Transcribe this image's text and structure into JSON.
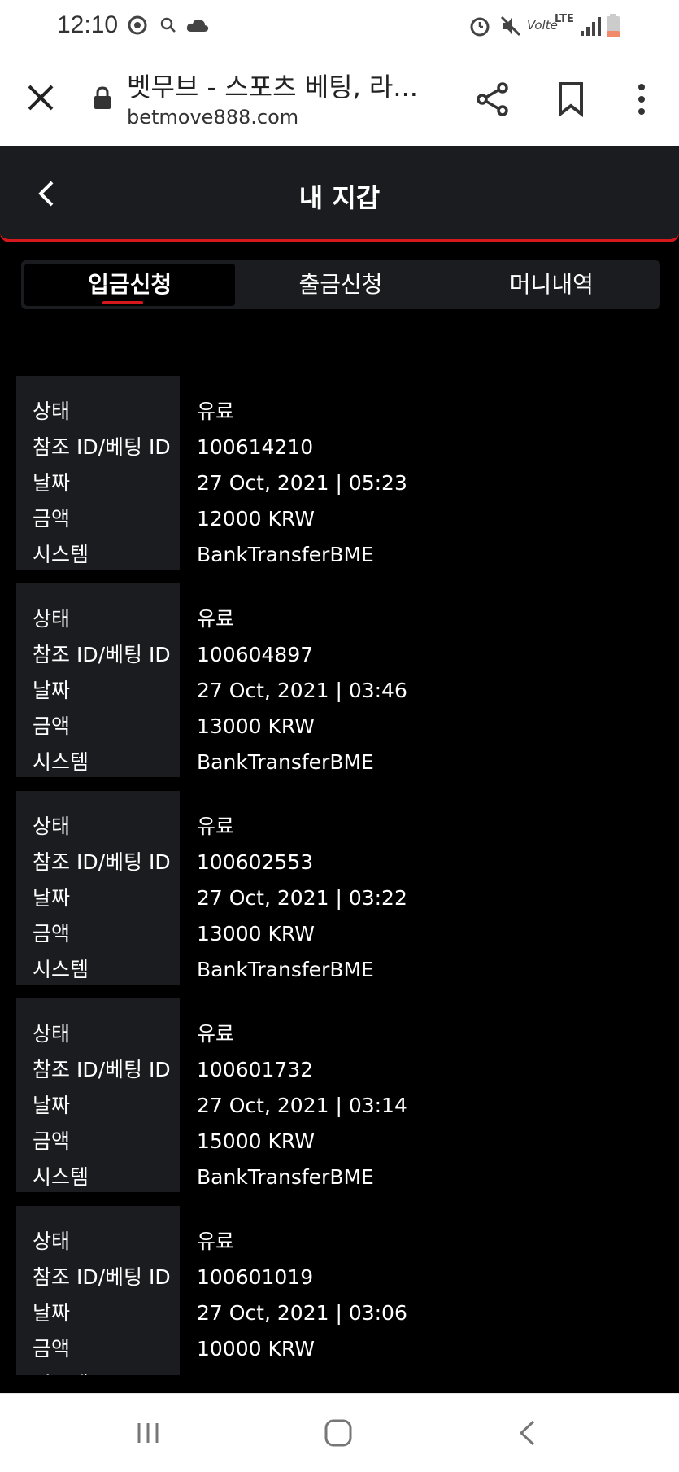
{
  "status_bar": {
    "time": "12:10",
    "network": "LTE",
    "volte": "Volte"
  },
  "browser": {
    "title": "벳무브 - 스포츠 베팅, 라...",
    "url": "betmove888.com"
  },
  "header": {
    "title": "내 지갑"
  },
  "tabs": [
    {
      "label": "입금신청",
      "active": true
    },
    {
      "label": "출금신청",
      "active": false
    },
    {
      "label": "머니내역",
      "active": false
    }
  ],
  "labels": {
    "status": "상태",
    "ref_id": "참조 ID/베팅 ID",
    "date": "날짜",
    "amount": "금액",
    "system": "시스템"
  },
  "records": [
    {
      "status": "유료",
      "ref_id": "100614210",
      "date": "27 Oct, 2021 | 05:23",
      "amount": "12000 KRW",
      "system": "BankTransferBME"
    },
    {
      "status": "유료",
      "ref_id": "100604897",
      "date": "27 Oct, 2021 | 03:46",
      "amount": "13000 KRW",
      "system": "BankTransferBME"
    },
    {
      "status": "유료",
      "ref_id": "100602553",
      "date": "27 Oct, 2021 | 03:22",
      "amount": "13000 KRW",
      "system": "BankTransferBME"
    },
    {
      "status": "유료",
      "ref_id": "100601732",
      "date": "27 Oct, 2021 | 03:14",
      "amount": "15000 KRW",
      "system": "BankTransferBME"
    },
    {
      "status": "유료",
      "ref_id": "100601019",
      "date": "27 Oct, 2021 | 03:06",
      "amount": "10000 KRW",
      "system": "BankTransferBME"
    }
  ],
  "colors": {
    "accent": "#d4181b",
    "panel": "#1b1c20",
    "background": "#000000"
  },
  "icons": {
    "close": "close-icon",
    "lock": "lock-icon",
    "share": "share-icon",
    "bookmark": "bookmark-icon",
    "more": "more-vert-icon",
    "back": "chevron-left-icon"
  }
}
